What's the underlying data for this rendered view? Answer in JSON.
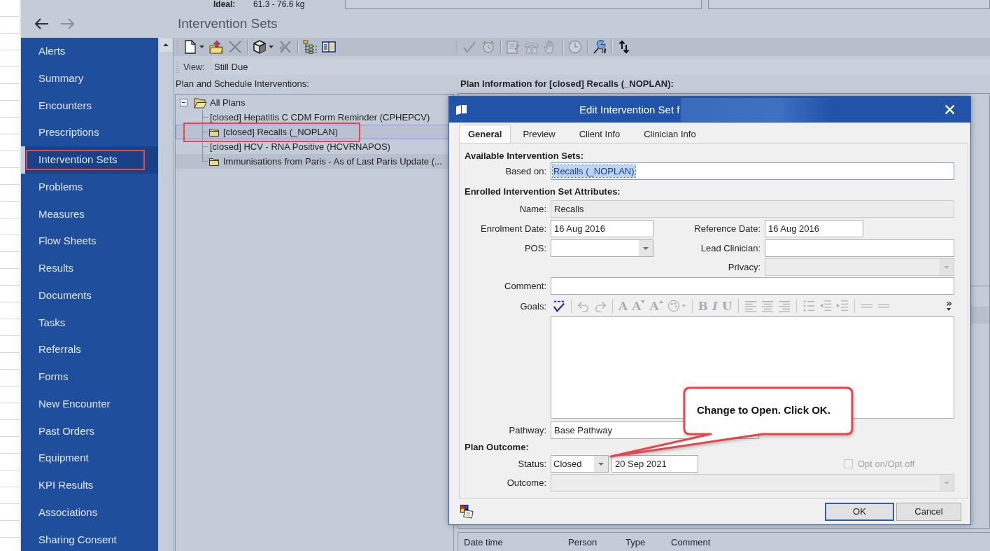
{
  "header": {
    "ideal_label": "Ideal:",
    "ideal_value": "61.3 - 76.6 kg"
  },
  "navigation": [
    {
      "kind": "back",
      "disabled": false
    },
    {
      "kind": "forward",
      "disabled": true
    }
  ],
  "page_title": "Intervention Sets",
  "sidebar": {
    "items": [
      {
        "label": "Alerts",
        "selected": false,
        "annotated": false
      },
      {
        "label": "Summary",
        "selected": false,
        "annotated": false
      },
      {
        "label": "Encounters",
        "selected": false,
        "annotated": false
      },
      {
        "label": "Prescriptions",
        "selected": false,
        "annotated": false
      },
      {
        "label": "Intervention Sets",
        "selected": true,
        "annotated": true
      },
      {
        "label": "Problems",
        "selected": false,
        "annotated": false
      },
      {
        "label": "Measures",
        "selected": false,
        "annotated": false
      },
      {
        "label": "Flow Sheets",
        "selected": false,
        "annotated": false
      },
      {
        "label": "Results",
        "selected": false,
        "annotated": false
      },
      {
        "label": "Documents",
        "selected": false,
        "annotated": false
      },
      {
        "label": "Tasks",
        "selected": false,
        "annotated": false
      },
      {
        "label": "Referrals",
        "selected": false,
        "annotated": false
      },
      {
        "label": "Forms",
        "selected": false,
        "annotated": false
      },
      {
        "label": "New Encounter",
        "selected": false,
        "annotated": false
      },
      {
        "label": "Past Orders",
        "selected": false,
        "annotated": false
      },
      {
        "label": "Equipment",
        "selected": false,
        "annotated": false
      },
      {
        "label": "KPI Results",
        "selected": false,
        "annotated": false
      },
      {
        "label": "Associations",
        "selected": false,
        "annotated": false
      },
      {
        "label": "Sharing Consent",
        "selected": false,
        "annotated": false
      }
    ]
  },
  "toolbar": {
    "groups": [
      {
        "items": [
          {
            "kind": "new",
            "disabled": false,
            "dropdown": true
          },
          {
            "kind": "import",
            "disabled": false,
            "dropdown": false
          },
          {
            "kind": "delete",
            "disabled": true,
            "dropdown": false
          },
          {
            "kind": "separator"
          },
          {
            "kind": "package",
            "disabled": false,
            "dropdown": true
          },
          {
            "kind": "prune",
            "disabled": true,
            "dropdown": false
          },
          {
            "kind": "separator"
          },
          {
            "kind": "tree",
            "disabled": false,
            "dropdown": false
          },
          {
            "kind": "columns",
            "disabled": false,
            "dropdown": false
          }
        ]
      },
      {
        "items": [
          {
            "kind": "tick",
            "disabled": true,
            "dropdown": false
          },
          {
            "kind": "alarm",
            "disabled": true,
            "dropdown": false
          },
          {
            "kind": "separator"
          },
          {
            "kind": "note",
            "disabled": true,
            "dropdown": false
          },
          {
            "kind": "phone",
            "disabled": true,
            "dropdown": false
          },
          {
            "kind": "hand",
            "disabled": true,
            "dropdown": false
          },
          {
            "kind": "separator"
          },
          {
            "kind": "clock",
            "disabled": true,
            "dropdown": false
          },
          {
            "kind": "separator"
          },
          {
            "kind": "pin",
            "disabled": false,
            "dropdown": false
          },
          {
            "kind": "separator"
          },
          {
            "kind": "refresh",
            "disabled": false,
            "dropdown": false
          }
        ]
      }
    ]
  },
  "view": {
    "label": "View:",
    "value": "Still Due"
  },
  "plans_panel": {
    "title": "Plan and Schedule Interventions:",
    "tree": [
      {
        "label": "All Plans",
        "kind": "folder",
        "expanded": true,
        "selected": false,
        "annotated": false,
        "children": [
          {
            "label": "[closed] Hepatitis C CDM Form Reminder (CPHEPCV)",
            "kind": "item",
            "selected": false,
            "annotated": false
          },
          {
            "label": "[closed] Recalls (_NOPLAN)",
            "kind": "folder",
            "selected": true,
            "annotated": true
          },
          {
            "label": "[closed] HCV - RNA Positive (HCVRNAPOS)",
            "kind": "item",
            "selected": false,
            "annotated": false
          },
          {
            "label": "Immunisations from Paris - As of Last Paris Update (...",
            "kind": "folder",
            "selected": false,
            "annotated": false
          }
        ]
      }
    ]
  },
  "plan_info": {
    "title": "Plan Information for [closed] Recalls (_NOPLAN):",
    "history_columns": [
      "Date time",
      "Person",
      "Type",
      "Comment"
    ]
  },
  "dialog": {
    "title": "Edit Intervention Set f",
    "title_redacted": true,
    "tabs": [
      {
        "label": "General",
        "selected": true
      },
      {
        "label": "Preview",
        "selected": false
      },
      {
        "label": "Client Info",
        "selected": false
      },
      {
        "label": "Clinician Info",
        "selected": false
      }
    ],
    "available_heading": "Available Intervention Sets:",
    "based_on": {
      "label": "Based on:",
      "value": "Recalls (_NOPLAN)",
      "text_selected": true
    },
    "attributes_heading": "Enrolled Intervention Set Attributes:",
    "name": {
      "label": "Name:",
      "value": "Recalls",
      "disabled": true
    },
    "enrolment_date": {
      "label": "Enrolment Date:",
      "value": "16 Aug 2016"
    },
    "reference_date": {
      "label": "Reference Date:",
      "value": "16 Aug 2016"
    },
    "pos": {
      "label": "POS:"
    },
    "lead_clinician": {
      "label": "Lead Clinician:"
    },
    "privacy": {
      "label": "Privacy:",
      "disabled": true
    },
    "comment": {
      "label": "Comment:"
    },
    "goals": {
      "label": "Goals:",
      "toolbar": [
        {
          "kind": "spellcheck",
          "disabled": false
        },
        {
          "kind": "separator"
        },
        {
          "kind": "undo",
          "disabled": true
        },
        {
          "kind": "redo",
          "disabled": true
        },
        {
          "kind": "separator"
        },
        {
          "kind": "font",
          "glyph": "A",
          "disabled": true
        },
        {
          "kind": "grow",
          "glyph": "A",
          "disabled": true
        },
        {
          "kind": "shrink",
          "glyph": "A",
          "disabled": true
        },
        {
          "kind": "highlight",
          "disabled": true
        },
        {
          "kind": "separator"
        },
        {
          "kind": "bold",
          "glyph": "B",
          "disabled": true
        },
        {
          "kind": "italic",
          "glyph": "I",
          "disabled": true
        },
        {
          "kind": "underline",
          "glyph": "U",
          "disabled": true
        },
        {
          "kind": "separator"
        },
        {
          "kind": "left",
          "disabled": true
        },
        {
          "kind": "center",
          "disabled": true
        },
        {
          "kind": "right",
          "disabled": true
        },
        {
          "kind": "separator"
        },
        {
          "kind": "bullets",
          "disabled": true
        },
        {
          "kind": "outdent",
          "disabled": true
        },
        {
          "kind": "indent",
          "disabled": true
        },
        {
          "kind": "separator"
        },
        {
          "kind": "rule",
          "disabled": true
        },
        {
          "kind": "rule",
          "disabled": true
        },
        {
          "kind": "more",
          "glyph": "»",
          "disabled": false
        }
      ]
    },
    "pathway": {
      "label": "Pathway:",
      "value": "Base Pathway"
    },
    "outcome_heading": "Plan Outcome:",
    "status": {
      "label": "Status:",
      "value": "Closed",
      "date": "20 Sep 2021"
    },
    "opt_in": {
      "label": "Opt on/Opt off",
      "checked": false,
      "disabled": true
    },
    "outcome": {
      "label": "Outcome:",
      "disabled": true
    },
    "buttons": [
      {
        "label": "OK",
        "default": true
      },
      {
        "label": "Cancel",
        "default": false
      }
    ]
  },
  "callout": {
    "text": "Change to Open. Click OK."
  }
}
